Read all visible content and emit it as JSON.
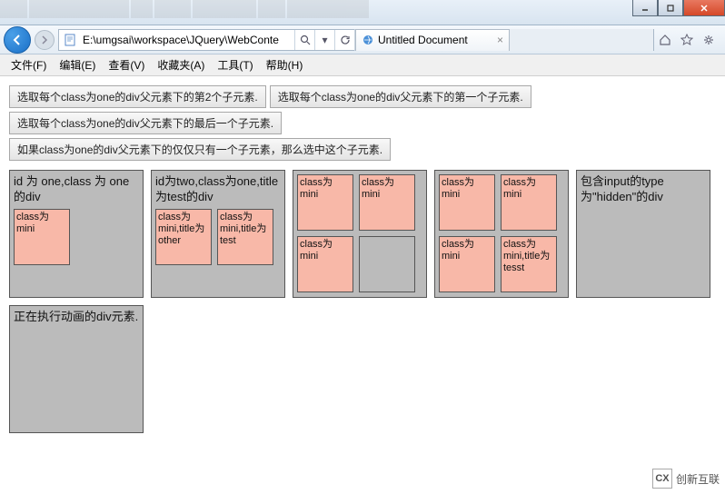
{
  "window": {
    "min_tip": "Minimize",
    "max_tip": "Maximize",
    "close_tip": "Close"
  },
  "nav": {
    "url": "E:\\umgsai\\workspace\\JQuery\\WebConte",
    "tab_title": "Untitled Document"
  },
  "menu": {
    "file": "文件(F)",
    "edit": "编辑(E)",
    "view": "查看(V)",
    "fav": "收藏夹(A)",
    "tools": "工具(T)",
    "help": "帮助(H)"
  },
  "buttons": {
    "b1": "选取每个class为one的div父元素下的第2个子元素.",
    "b2": "选取每个class为one的div父元素下的第一个子元素.",
    "b3": "选取每个class为one的div父元素下的最后一个子元素.",
    "b4": "如果class为one的div父元素下的仅仅只有一个子元素，那么选中这个子元素."
  },
  "boxes": {
    "one": {
      "title": "id 为 one,class 为 one 的div",
      "mini1": "class为mini"
    },
    "two": {
      "title": "id为two,class为one,title为test的div",
      "mini1": "class为mini,title为other",
      "mini2": "class为mini,title为test"
    },
    "three": {
      "mini1": "class为mini",
      "mini2": "class为mini",
      "mini3": "class为mini"
    },
    "four": {
      "mini1": "class为mini",
      "mini2": "class为mini",
      "mini3": "class为mini",
      "mini4": "class为mini,title为tesst"
    },
    "five": {
      "title": "包含input的type为\"hidden\"的div"
    },
    "six": {
      "title": "正在执行动画的div元素."
    }
  },
  "watermark": {
    "logo": "CX",
    "text": "创新互联"
  }
}
